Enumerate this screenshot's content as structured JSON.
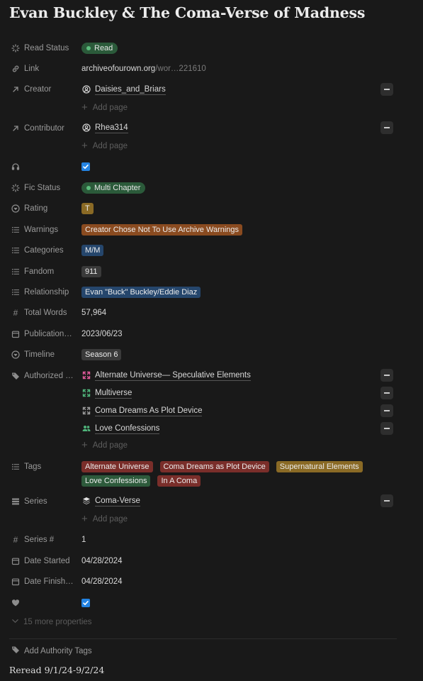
{
  "page": {
    "title": "Evan Buckley & The Coma-Verse of Madness"
  },
  "colors": {
    "bg": "#191919",
    "green_pill": "#2b5a3a",
    "green_dot": "#5cbd7c",
    "orange_tag": "#8a4b20",
    "blue_tag": "#25466c",
    "gray_tag": "#3a3a3a",
    "yellow_tag": "#8a6a25",
    "red_tag": "#7a2e2a",
    "green_tag": "#2d5a3b",
    "check_blue": "#2383e2"
  },
  "properties": {
    "read_status": {
      "label": "Read Status",
      "value": "Read"
    },
    "link": {
      "label": "Link",
      "value_main": "archiveofourown.org",
      "value_muted": "/wor…221610"
    },
    "creator": {
      "label": "Creator",
      "value": "Daisies_and_Briars",
      "add": "Add page"
    },
    "contributor": {
      "label": "Contributor",
      "value": "Rhea314",
      "add": "Add page"
    },
    "audio": {
      "label": "",
      "checked": true
    },
    "fic_status": {
      "label": "Fic Status",
      "value": "Multi Chapter"
    },
    "rating": {
      "label": "Rating",
      "value": "T"
    },
    "warnings": {
      "label": "Warnings",
      "value": "Creator Chose Not To Use Archive Warnings"
    },
    "categories": {
      "label": "Categories",
      "value": "M/M"
    },
    "fandom": {
      "label": "Fandom",
      "value": "911"
    },
    "relationship": {
      "label": "Relationship",
      "value": "Evan \"Buck\" Buckley/Eddie Diaz"
    },
    "total_words": {
      "label": "Total Words",
      "value": "57,964"
    },
    "publication": {
      "label": "Publication…",
      "value": "2023/06/23"
    },
    "timeline": {
      "label": "Timeline",
      "value": "Season 6"
    },
    "authorized": {
      "label": "Authorized …",
      "items": [
        {
          "label": "Alternate Universe— Speculative Elements",
          "icon": "expand-icon-pink"
        },
        {
          "label": "Multiverse",
          "icon": "expand-icon-green"
        },
        {
          "label": "Coma Dreams As Plot Device",
          "icon": "expand-icon-gray"
        },
        {
          "label": "Love Confessions",
          "icon": "people-icon-green"
        }
      ],
      "add": "Add page"
    },
    "tags": {
      "label": "Tags",
      "items": [
        {
          "label": "Alternate Universe",
          "color": "#7a2e2a"
        },
        {
          "label": "Coma Dreams as Plot Device",
          "color": "#7a2e2a"
        },
        {
          "label": "Supernatural Elements",
          "color": "#8a6a25"
        },
        {
          "label": "Love Confessions",
          "color": "#2d5a3b"
        },
        {
          "label": "In A Coma",
          "color": "#7a2e2a"
        }
      ]
    },
    "series": {
      "label": "Series",
      "value": "Coma-Verse",
      "add": "Add page"
    },
    "series_num": {
      "label": "Series #",
      "value": "1"
    },
    "date_started": {
      "label": "Date Started",
      "value": "04/28/2024"
    },
    "date_finished": {
      "label": "Date Finish…",
      "value": "04/28/2024"
    },
    "favorite": {
      "label": "",
      "checked": true
    }
  },
  "more_properties": "15 more properties",
  "add_authority_tags": "Add Authority Tags",
  "footer_note": "Reread 9/1/24-9/2/24"
}
